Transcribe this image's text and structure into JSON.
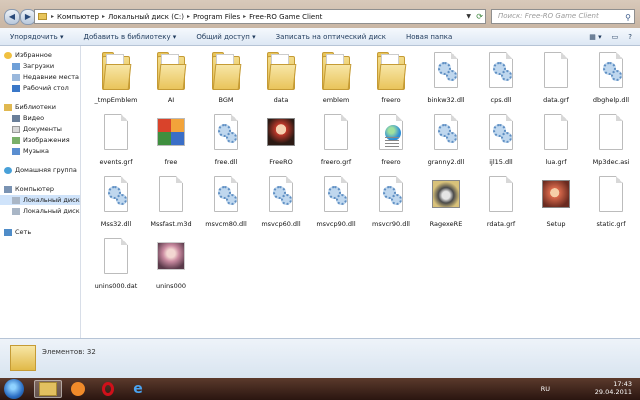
{
  "address_bar": {
    "breadcrumbs": [
      "Компьютер",
      "Локальный диск (C:)",
      "Program Files",
      "Free-RO Game Client"
    ],
    "search_placeholder": "Поиск: Free-RO Game Client"
  },
  "toolbar": {
    "organize": "Упорядочить ▾",
    "add_to_library": "Добавить в библиотеку ▾",
    "share": "Общий доступ ▾",
    "burn": "Записать на оптический диск",
    "new_folder": "Новая папка"
  },
  "nav": {
    "favorites": "Избранное",
    "downloads": "Загрузки",
    "recent": "Недавние места",
    "desktop": "Рабочий стол",
    "libraries": "Библиотеки",
    "video": "Видео",
    "documents": "Документы",
    "images": "Изображения",
    "music": "Музыка",
    "homegroup": "Домашняя группа",
    "computer": "Компьютер",
    "disk_c": "Локальный диск (C:)",
    "disk_d": "Локальный диск (D:)",
    "network": "Сеть"
  },
  "files": [
    {
      "name": "_tmpEmblem",
      "type": "folder"
    },
    {
      "name": "AI",
      "type": "folder"
    },
    {
      "name": "BGM",
      "type": "folder"
    },
    {
      "name": "data",
      "type": "folder"
    },
    {
      "name": "emblem",
      "type": "folder"
    },
    {
      "name": "freero",
      "type": "folder"
    },
    {
      "name": "binkw32.dll",
      "type": "dll"
    },
    {
      "name": "cps.dll",
      "type": "dll"
    },
    {
      "name": "data.grf",
      "type": "doc"
    },
    {
      "name": "dbghelp.dll",
      "type": "dll"
    },
    {
      "name": "events.grf",
      "type": "doc"
    },
    {
      "name": "free",
      "type": "office"
    },
    {
      "name": "free.dll",
      "type": "dll"
    },
    {
      "name": "FreeRO",
      "type": "anime"
    },
    {
      "name": "freero.grf",
      "type": "doc"
    },
    {
      "name": "freero",
      "type": "web"
    },
    {
      "name": "granny2.dll",
      "type": "dll"
    },
    {
      "name": "ijl15.dll",
      "type": "dll"
    },
    {
      "name": "lua.grf",
      "type": "doc"
    },
    {
      "name": "Mp3dec.asi",
      "type": "doc"
    },
    {
      "name": "Mss32.dll",
      "type": "dll"
    },
    {
      "name": "Mssfast.m3d",
      "type": "doc"
    },
    {
      "name": "msvcm80.dll",
      "type": "dll"
    },
    {
      "name": "msvcp60.dll",
      "type": "dll"
    },
    {
      "name": "msvcp90.dll",
      "type": "dll"
    },
    {
      "name": "msvcr90.dll",
      "type": "dll"
    },
    {
      "name": "RagexeRE",
      "type": "ragexe"
    },
    {
      "name": "rdata.grf",
      "type": "doc"
    },
    {
      "name": "Setup",
      "type": "setup"
    },
    {
      "name": "static.grf",
      "type": "doc"
    },
    {
      "name": "unins000.dat",
      "type": "doc"
    },
    {
      "name": "unins000",
      "type": "unins"
    }
  ],
  "details": {
    "count_text": "Элементов: 32"
  },
  "taskbar": {
    "lang": "RU",
    "time": "17:43",
    "date": "29.04.2011"
  }
}
